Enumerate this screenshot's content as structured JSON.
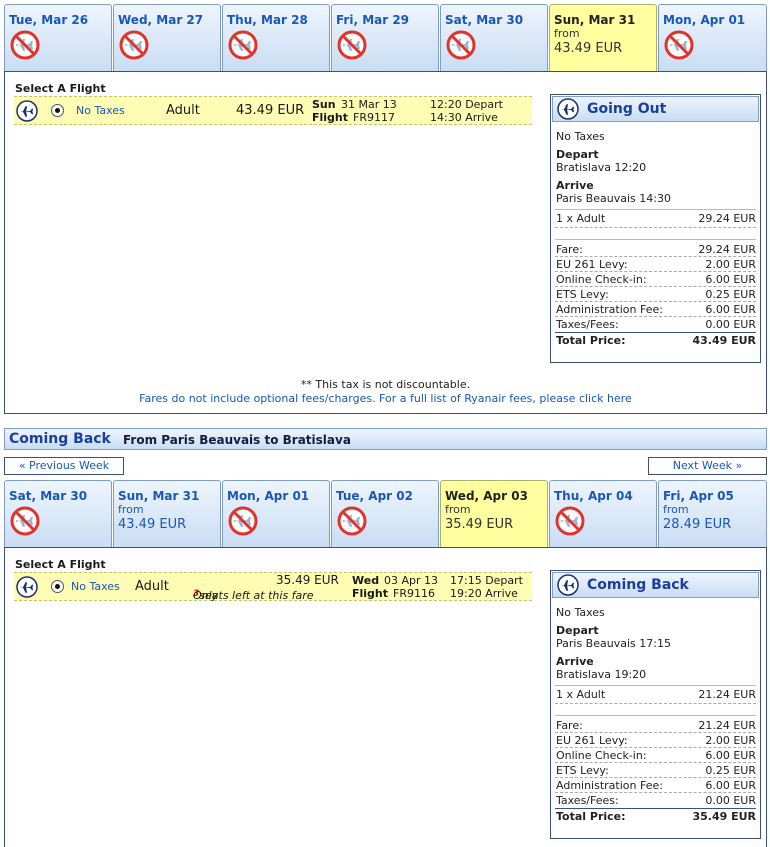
{
  "outbound": {
    "days": [
      {
        "label": "Tue, Mar 26",
        "available": false
      },
      {
        "label": "Wed, Mar 27",
        "available": false
      },
      {
        "label": "Thu, Mar 28",
        "available": false
      },
      {
        "label": "Fri, Mar 29",
        "available": false
      },
      {
        "label": "Sat, Mar 30",
        "available": false
      },
      {
        "label": "Sun, Mar 31",
        "available": true,
        "selected": true,
        "from": "from",
        "price": "43.49 EUR"
      },
      {
        "label": "Mon, Apr 01",
        "available": false
      }
    ],
    "select_heading": "Select A Flight",
    "flight": {
      "fare_type": "No Taxes",
      "passenger": "Adult",
      "price": "43.49 EUR",
      "day": "Sun",
      "date": "31 Mar 13",
      "flight_label": "Flight",
      "flight_no": "FR9117",
      "depart": "12:20 Depart",
      "arrive": "14:30 Arrive"
    },
    "summary": {
      "title": "Going Out",
      "fare_type": "No Taxes",
      "depart_label": "Depart",
      "depart_value": "Bratislava 12:20",
      "arrive_label": "Arrive",
      "arrive_value": "Paris Beauvais 14:30",
      "pax_label": "1 x Adult",
      "pax_value": "29.24 EUR",
      "lines": [
        {
          "label": "Fare:",
          "value": "29.24 EUR"
        },
        {
          "label": "EU 261 Levy:",
          "value": "2.00 EUR"
        },
        {
          "label": "Online Check-in:",
          "value": "6.00 EUR"
        },
        {
          "label": "ETS Levy:",
          "value": "0.25 EUR"
        },
        {
          "label": "Administration Fee:",
          "value": "6.00 EUR"
        },
        {
          "label": "Taxes/Fees:",
          "value": "0.00 EUR"
        }
      ],
      "total_label": "Total Price:",
      "total_value": "43.49 EUR"
    },
    "note1": "** This tax is not discountable.",
    "note2": "Fares do not include optional fees/charges. For a full list of Ryanair fees, please click here"
  },
  "return": {
    "section_title": "Coming Back",
    "section_route": "From Paris Beauvais to Bratislava",
    "prev_week": "« Previous Week",
    "next_week": "Next Week »",
    "days": [
      {
        "label": "Sat, Mar 30",
        "available": false
      },
      {
        "label": "Sun, Mar 31",
        "available": true,
        "from": "from",
        "price": "43.49 EUR"
      },
      {
        "label": "Mon, Apr 01",
        "available": false
      },
      {
        "label": "Tue, Apr 02",
        "available": false
      },
      {
        "label": "Wed, Apr 03",
        "available": true,
        "selected": true,
        "from": "from",
        "price": "35.49 EUR"
      },
      {
        "label": "Thu, Apr 04",
        "available": false
      },
      {
        "label": "Fri, Apr 05",
        "available": true,
        "from": "from",
        "price": "28.49 EUR"
      }
    ],
    "select_heading": "Select A Flight",
    "flight": {
      "fare_type": "No Taxes",
      "passenger": "Adult",
      "price": "35.49 EUR",
      "seats_pre": "Only",
      "seats_num": "3",
      "seats_post": "seats left at this fare",
      "day": "Wed",
      "date": "03 Apr 13",
      "flight_label": "Flight",
      "flight_no": "FR9116",
      "depart": "17:15 Depart",
      "arrive": "19:20 Arrive"
    },
    "summary": {
      "title": "Coming Back",
      "fare_type": "No Taxes",
      "depart_label": "Depart",
      "depart_value": "Paris Beauvais 17:15",
      "arrive_label": "Arrive",
      "arrive_value": "Bratislava 19:20",
      "pax_label": "1 x Adult",
      "pax_value": "21.24 EUR",
      "lines": [
        {
          "label": "Fare:",
          "value": "21.24 EUR"
        },
        {
          "label": "EU 261 Levy:",
          "value": "2.00 EUR"
        },
        {
          "label": "Online Check-in:",
          "value": "6.00 EUR"
        },
        {
          "label": "ETS Levy:",
          "value": "0.25 EUR"
        },
        {
          "label": "Administration Fee:",
          "value": "6.00 EUR"
        },
        {
          "label": "Taxes/Fees:",
          "value": "0.00 EUR"
        }
      ],
      "total_label": "Total Price:",
      "total_value": "35.49 EUR"
    }
  }
}
